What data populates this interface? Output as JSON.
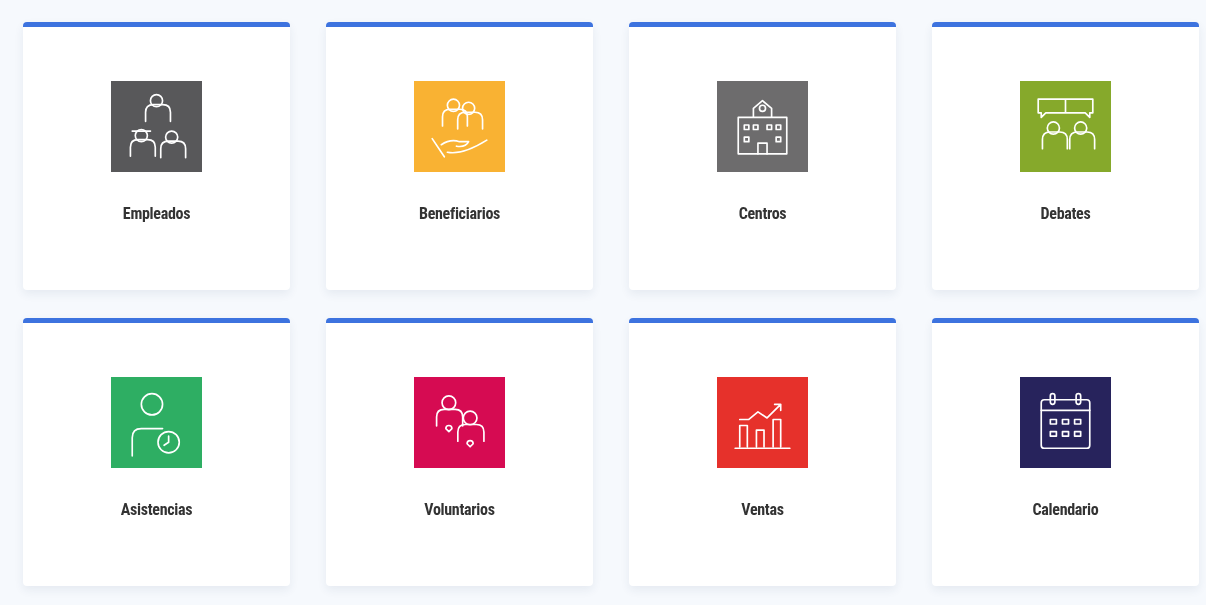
{
  "cards": [
    {
      "label": "Empleados",
      "color": "#58585a"
    },
    {
      "label": "Beneficiarios",
      "color": "#f9b233"
    },
    {
      "label": "Centros",
      "color": "#6d6c6d"
    },
    {
      "label": "Debates",
      "color": "#86a92b"
    },
    {
      "label": "Asistencias",
      "color": "#2eae63"
    },
    {
      "label": "Voluntarios",
      "color": "#d60b52"
    },
    {
      "label": "Ventas",
      "color": "#e6312b"
    },
    {
      "label": "Calendario",
      "color": "#27235c"
    }
  ]
}
